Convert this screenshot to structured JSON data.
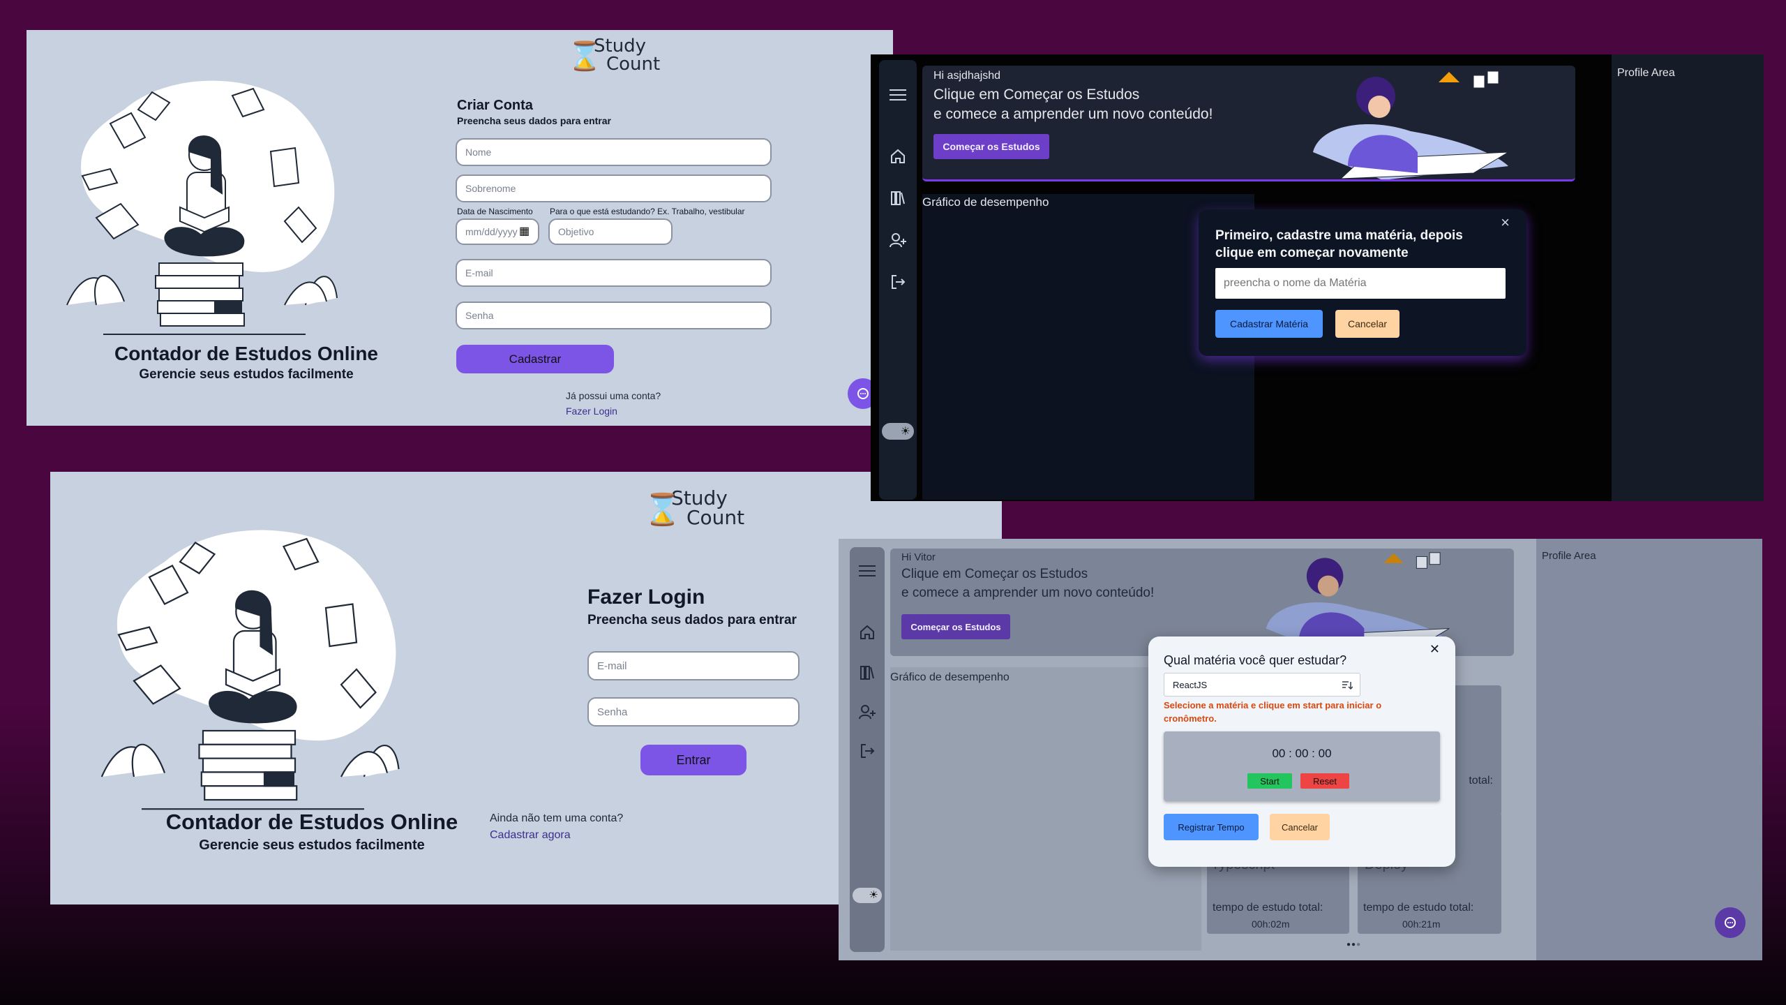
{
  "register": {
    "logo_line1": "Study",
    "logo_line2": "Count",
    "brand_title": "Contador de Estudos Online",
    "brand_subtitle": "Gerencie seus estudos facilmente",
    "form_title": "Criar Conta",
    "form_subtitle": "Preencha seus dados para entrar",
    "first_name_placeholder": "Nome",
    "last_name_placeholder": "Sobrenome",
    "birth_label": "Data de Nascimento",
    "birth_placeholder": "mm/dd/yyyy",
    "goal_label": "Para o que está estudando? Ex. Trabalho, vestibular",
    "goal_placeholder": "Objetivo",
    "email_placeholder": "E-mail",
    "password_placeholder": "Senha",
    "submit_label": "Cadastrar",
    "have_account_text": "Já possui uma conta?",
    "login_link": "Fazer Login"
  },
  "login": {
    "logo_line1": "Study",
    "logo_line2": "Count",
    "brand_title": "Contador de Estudos Online",
    "brand_subtitle": "Gerencie seus estudos facilmente",
    "form_title": "Fazer Login",
    "form_subtitle": "Preencha seus dados para entrar",
    "email_placeholder": "E-mail",
    "password_placeholder": "Senha",
    "submit_label": "Entrar",
    "no_account_text": "Ainda não tem uma conta?",
    "signup_link": "Cadastrar agora"
  },
  "dark_dashboard": {
    "greeting": "Hi asjdhajshd",
    "hero_line1": "Clique em Começar os Estudos",
    "hero_line2": "e comece a amprender um novo conteúdo!",
    "start_button": "Começar os Estudos",
    "chart_title": "Gráfico de desempenho",
    "profile_area": "Profile Area",
    "modal_title": "Primeiro, cadastre uma matéria, depois clique em começar novamente",
    "modal_input_placeholder": "preencha o nome da Matéria",
    "modal_confirm": "Cadastrar Matéria",
    "modal_cancel": "Cancelar",
    "close_symbol": "×"
  },
  "light_dashboard": {
    "greeting": "Hi Vitor",
    "hero_line1": "Clique em Começar os Estudos",
    "hero_line2": "e comece a amprender um novo conteúdo!",
    "start_button": "Começar os Estudos",
    "chart_title": "Gráfico de desempenho",
    "profile_area": "Profile Area",
    "modal_title": "Qual matéria você quer estudar?",
    "subject_selected": "ReactJS",
    "hint": "Selecione a matéria e clique em start para iniciar o cronômetro.",
    "timer": "00 : 00 : 00",
    "timer_start": "Start",
    "timer_reset": "Reset",
    "register_time": "Registrar Tempo",
    "cancel": "Cancelar",
    "close_symbol": "✕",
    "cards": [
      {
        "partial_label": "total:",
        "subject": "",
        "time_label": "",
        "time": ""
      },
      {
        "partial_label": "",
        "subject": "Typescript",
        "time_label": "tempo de estudo total:",
        "time": "00h:02m"
      },
      {
        "partial_label": "",
        "subject": "Deploy",
        "time_label": "tempo de estudo total:",
        "time": "00h:21m"
      }
    ]
  },
  "colors": {
    "background": "#4a063e",
    "auth_panel": "#c8d1df",
    "accent_purple": "#7c55e6",
    "button_blue": "#4f95ff",
    "button_peach": "#ffd3a2",
    "start_green": "#22c55e",
    "reset_red": "#ef4444",
    "hint_red": "#d9480f"
  }
}
